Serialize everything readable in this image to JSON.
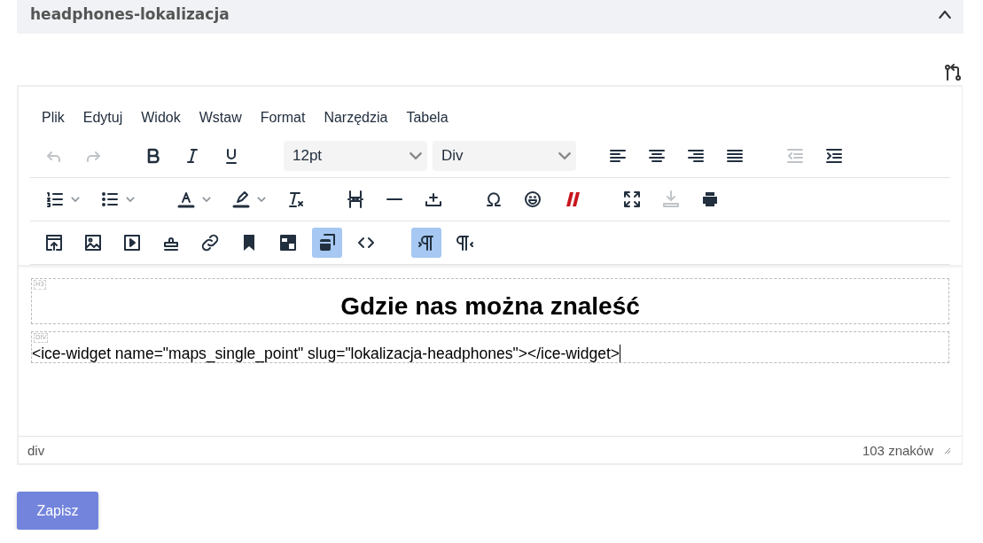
{
  "panel": {
    "title": "headphones-lokalizacja",
    "expanded": true
  },
  "editor": {
    "menubar": [
      "Plik",
      "Edytuj",
      "Widok",
      "Wstaw",
      "Format",
      "Narzędzia",
      "Tabela"
    ],
    "toolbar_rows": [
      [
        [
          {
            "kind": "button",
            "disabled": true,
            "selected": false
          },
          {
            "kind": "button",
            "disabled": true,
            "selected": false
          }
        ],
        [
          {
            "kind": "button",
            "disabled": false,
            "selected": false
          },
          {
            "kind": "button",
            "disabled": false,
            "selected": false
          },
          {
            "kind": "button",
            "disabled": false,
            "selected": false
          }
        ],
        [
          {
            "kind": "select",
            "value": "12pt"
          },
          {
            "kind": "select",
            "value": "Div"
          }
        ],
        [
          {
            "kind": "button",
            "disabled": false,
            "selected": false
          },
          {
            "kind": "button",
            "disabled": false,
            "selected": false
          },
          {
            "kind": "button",
            "disabled": false,
            "selected": false
          },
          {
            "kind": "button",
            "disabled": false,
            "selected": false
          }
        ],
        [
          {
            "kind": "button",
            "disabled": true,
            "selected": false
          },
          {
            "kind": "button",
            "disabled": false,
            "selected": false
          }
        ]
      ],
      [
        [
          {
            "kind": "split",
            "disabled": false,
            "selected": false
          },
          {
            "kind": "split",
            "disabled": false,
            "selected": false
          }
        ],
        [
          {
            "kind": "split",
            "disabled": false,
            "selected": false
          },
          {
            "kind": "split",
            "disabled": false,
            "selected": false
          },
          {
            "kind": "button",
            "disabled": false,
            "selected": false
          }
        ],
        [
          {
            "kind": "button",
            "disabled": false,
            "selected": false
          },
          {
            "kind": "button",
            "disabled": false,
            "selected": false
          },
          {
            "kind": "button",
            "disabled": false,
            "selected": false
          }
        ],
        [
          {
            "kind": "button",
            "disabled": false,
            "selected": false
          },
          {
            "kind": "button",
            "disabled": false,
            "selected": false
          },
          {
            "kind": "button",
            "disabled": false,
            "selected": false
          }
        ],
        [
          {
            "kind": "button",
            "disabled": false,
            "selected": false
          },
          {
            "kind": "button",
            "disabled": true,
            "selected": false
          },
          {
            "kind": "button",
            "disabled": false,
            "selected": false
          }
        ]
      ],
      [
        [
          {
            "kind": "button",
            "disabled": false,
            "selected": false
          },
          {
            "kind": "button",
            "disabled": false,
            "selected": false
          },
          {
            "kind": "button",
            "disabled": false,
            "selected": false
          },
          {
            "kind": "button",
            "disabled": false,
            "selected": false
          },
          {
            "kind": "button",
            "disabled": false,
            "selected": false
          },
          {
            "kind": "button",
            "disabled": false,
            "selected": false
          },
          {
            "kind": "button",
            "disabled": false,
            "selected": false
          },
          {
            "kind": "button",
            "disabled": false,
            "selected": true
          },
          {
            "kind": "button",
            "disabled": false,
            "selected": false
          }
        ],
        [
          {
            "kind": "button",
            "disabled": false,
            "selected": true
          },
          {
            "kind": "button",
            "disabled": false,
            "selected": false
          }
        ]
      ]
    ],
    "blocks": [
      {
        "kind": "heading",
        "tag": "H3",
        "text": "Gdzie nas można znaleść"
      },
      {
        "kind": "div",
        "tag": "DIV",
        "text": "<ice-widget name=\"maps_single_point\" slug=\"lokalizacja-headphones\"></ice-widget>"
      }
    ],
    "status_bar": {
      "path": "div",
      "count": "103 znaków"
    }
  },
  "save_button": "Zapisz"
}
